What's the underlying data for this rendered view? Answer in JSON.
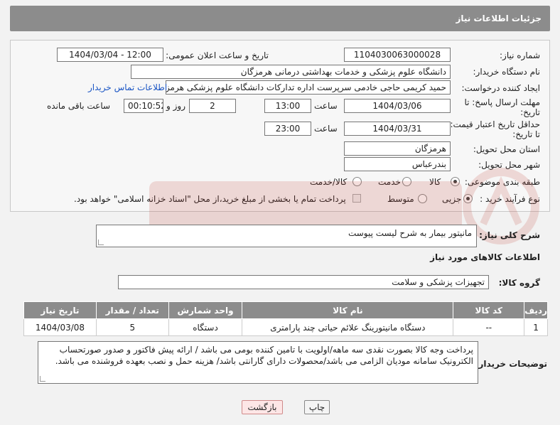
{
  "page_title": "جزئیات اطلاعات نیاز",
  "fields": {
    "need_number_label": "شماره نیاز:",
    "need_number": "1104030063000028",
    "announce_label": "تاریخ و ساعت اعلان عمومی:",
    "announce_value": "1404/03/04 - 12:00",
    "buyer_org_label": "نام دستگاه خریدار:",
    "buyer_org": "دانشگاه علوم پزشکی و خدمات بهداشتی درمانی هرمزگان",
    "requester_label": "ایجاد کننده درخواست:",
    "requester": "حمید کریمی حاجی خادمی سرپرست اداره تدارکات دانشگاه علوم پزشکی هرمزگان",
    "contact_link": "اطلاعات تماس خریدار",
    "deadline_label_1": "مهلت ارسال پاسخ: تا",
    "deadline_label_2": "تاریخ:",
    "deadline_date": "1404/03/06",
    "time_label": "ساعت",
    "deadline_time": "13:00",
    "days_value": "2",
    "days_label": "روز و",
    "remaining_time": "00:10:52",
    "remaining_label": "ساعت باقی مانده",
    "min_price_label_1": "حداقل تاریخ اعتبار قیمت:",
    "min_price_label_2": "تا تاریخ:",
    "validity_date": "1404/03/31",
    "validity_time": "23:00",
    "province_label": "استان محل تحویل:",
    "province": "هرمزگان",
    "city_label": "شهر محل تحویل:",
    "city": "بندرعباس",
    "category_label": "طبقه بندی موضوعی:",
    "category_options": [
      "کالا",
      "خدمت",
      "کالا/خدمت"
    ],
    "category_selected": "کالا",
    "process_label": "نوع فرآیند خرید :",
    "process_options": [
      "جزیی",
      "متوسط"
    ],
    "process_selected": "جزیی",
    "payment_note": "پرداخت تمام یا بخشی از مبلغ خرید،از محل \"اسناد خزانه اسلامی\" خواهد بود."
  },
  "summary": {
    "label": "شرح کلی نیاز:",
    "text": "مانیتور بیمار به شرح لیست پیوست"
  },
  "goods_section_title": "اطلاعات کالاهای مورد نیاز",
  "goods_group": {
    "label": "گروه کالا:",
    "value": "تجهیزات پزشکی و سلامت"
  },
  "table": {
    "headers": [
      "ردیف",
      "کد کالا",
      "نام کالا",
      "واحد شمارش",
      "تعداد / مقدار",
      "تاریخ نیاز"
    ],
    "rows": [
      [
        "1",
        "--",
        "دستگاه مانیتورینگ علائم حیاتی چند پارامتری",
        "دستگاه",
        "5",
        "1404/03/08"
      ]
    ]
  },
  "buyer_notes": {
    "label": "توضیحات خریدار:",
    "text": "پرداخت وجه کالا بصورت نقدی سه ماهه/اولویت با تامین کننده بومی می باشد / ارائه پیش فاکتور و صدور صورتحساب الکترونیک سامانه مودیان الزامی می باشد/محصولات دارای گارانتی باشد/ هزینه حمل و نصب بعهده فروشنده می باشد."
  },
  "buttons": {
    "print": "چاپ",
    "back": "بازگشت"
  },
  "colors": {
    "header_bg": "#8c8c8c",
    "link": "#1a55c4",
    "watermark": "#c0392b"
  }
}
